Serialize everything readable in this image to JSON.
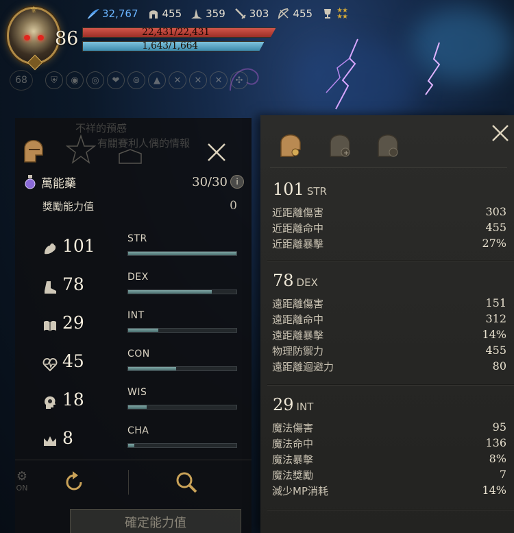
{
  "hud": {
    "level": "86",
    "stats": [
      {
        "icon": "feather-icon",
        "value": "32,767",
        "color": "#6ab4ff"
      },
      {
        "icon": "helmet-icon",
        "value": "455"
      },
      {
        "icon": "wizard-hat-icon",
        "value": "359"
      },
      {
        "icon": "sword-icon",
        "value": "303"
      },
      {
        "icon": "crossed-bow-icon",
        "value": "455"
      }
    ],
    "trophy_icon": "trophy-icon",
    "hp_text": "22,431/22,431",
    "mp_text": "1,643/1,664",
    "hp_fraction": 1.0,
    "mp_fraction": 0.987,
    "buff_count": "68"
  },
  "left_panel": {
    "ghost_text_1": "不祥的預感",
    "ghost_text_2": "有關賽利人偶的情報",
    "potion_name": "萬能藥",
    "potion_count": "30/30",
    "info_label": "i",
    "bonus_label": "獎勵能力值",
    "bonus_value": "0",
    "attributes": [
      {
        "icon": "arm-icon",
        "value": "101",
        "name": "STR",
        "fill": 1.0
      },
      {
        "icon": "boot-icon",
        "value": "78",
        "name": "DEX",
        "fill": 0.77
      },
      {
        "icon": "book-icon",
        "value": "29",
        "name": "INT",
        "fill": 0.28
      },
      {
        "icon": "heartbeat-icon",
        "value": "45",
        "name": "CON",
        "fill": 0.44
      },
      {
        "icon": "head-icon",
        "value": "18",
        "name": "WIS",
        "fill": 0.17
      },
      {
        "icon": "crown-icon",
        "value": "8",
        "name": "CHA",
        "fill": 0.06
      }
    ],
    "on_label": "ON",
    "confirm_label": "確定能力值"
  },
  "right_panel": {
    "sections": [
      {
        "num": "101",
        "abbr": "STR",
        "rows": [
          {
            "label": "近距離傷害",
            "value": "303"
          },
          {
            "label": "近距離命中",
            "value": "455"
          },
          {
            "label": "近距離暴擊",
            "value": "27%"
          }
        ]
      },
      {
        "num": "78",
        "abbr": "DEX",
        "rows": [
          {
            "label": "遠距離傷害",
            "value": "151"
          },
          {
            "label": "遠距離命中",
            "value": "312"
          },
          {
            "label": "遠距離暴擊",
            "value": "14%"
          },
          {
            "label": "物理防禦力",
            "value": "455"
          },
          {
            "label": "遠距離迴避力",
            "value": "80"
          }
        ]
      },
      {
        "num": "29",
        "abbr": "INT",
        "rows": [
          {
            "label": "魔法傷害",
            "value": "95"
          },
          {
            "label": "魔法命中",
            "value": "136"
          },
          {
            "label": "魔法暴擊",
            "value": "8%"
          },
          {
            "label": "魔法獎勵",
            "value": "7"
          },
          {
            "label": "減少MP消耗",
            "value": "14%"
          }
        ]
      }
    ]
  },
  "colors": {
    "hp": "#c8463c",
    "mp": "#5aa7c8",
    "gold_accent": "#c9a258",
    "stat_fill": "#6e9a99"
  }
}
